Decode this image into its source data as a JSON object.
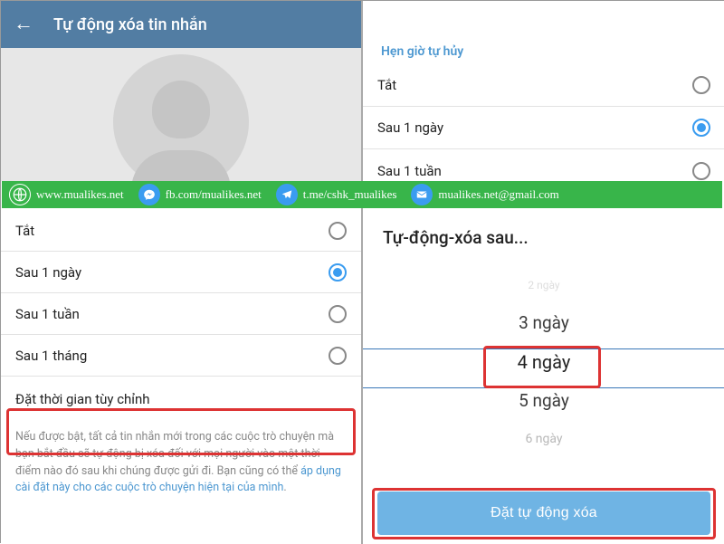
{
  "header": {
    "title": "Tự động xóa tin nhắn"
  },
  "section_title": "Hẹn giờ tự hủy",
  "left_options": [
    {
      "label": "Tắt",
      "checked": false
    },
    {
      "label": "Sau 1 ngày",
      "checked": true
    },
    {
      "label": "Sau 1 tuần",
      "checked": false
    },
    {
      "label": "Sau 1 tháng",
      "checked": false
    },
    {
      "label": "Đặt thời gian tùy chỉnh",
      "checked": null
    }
  ],
  "footnote": {
    "text": "Nếu được bật, tất cả tin nhắn mới trong các cuộc trò chuyện mà bạn bắt đầu sẽ tự động bị xóa đối với mọi người vào một thời điểm nào đó sau khi chúng được gửi đi. Bạn cũng có thể ",
    "link": "áp dụng cài đặt này cho các cuộc trò chuyện hiện tại của mình",
    "tail": "."
  },
  "right_options": [
    {
      "label": "Tắt",
      "checked": false
    },
    {
      "label": "Sau 1 ngày",
      "checked": true
    },
    {
      "label": "Sau 1 tuần",
      "checked": false
    }
  ],
  "picker": {
    "title": "Tự-động-xóa sau...",
    "items": [
      "2 ngày",
      "3 ngày",
      "4 ngày",
      "5 ngày",
      "6 ngày"
    ],
    "selected": "4 ngày",
    "button": "Đặt tự động xóa"
  },
  "banner": {
    "site": "www.mualikes.net",
    "fb": "fb.com/mualikes.net",
    "tg": "t.me/cshk_mualikes",
    "email": "mualikes.net@gmail.com"
  }
}
